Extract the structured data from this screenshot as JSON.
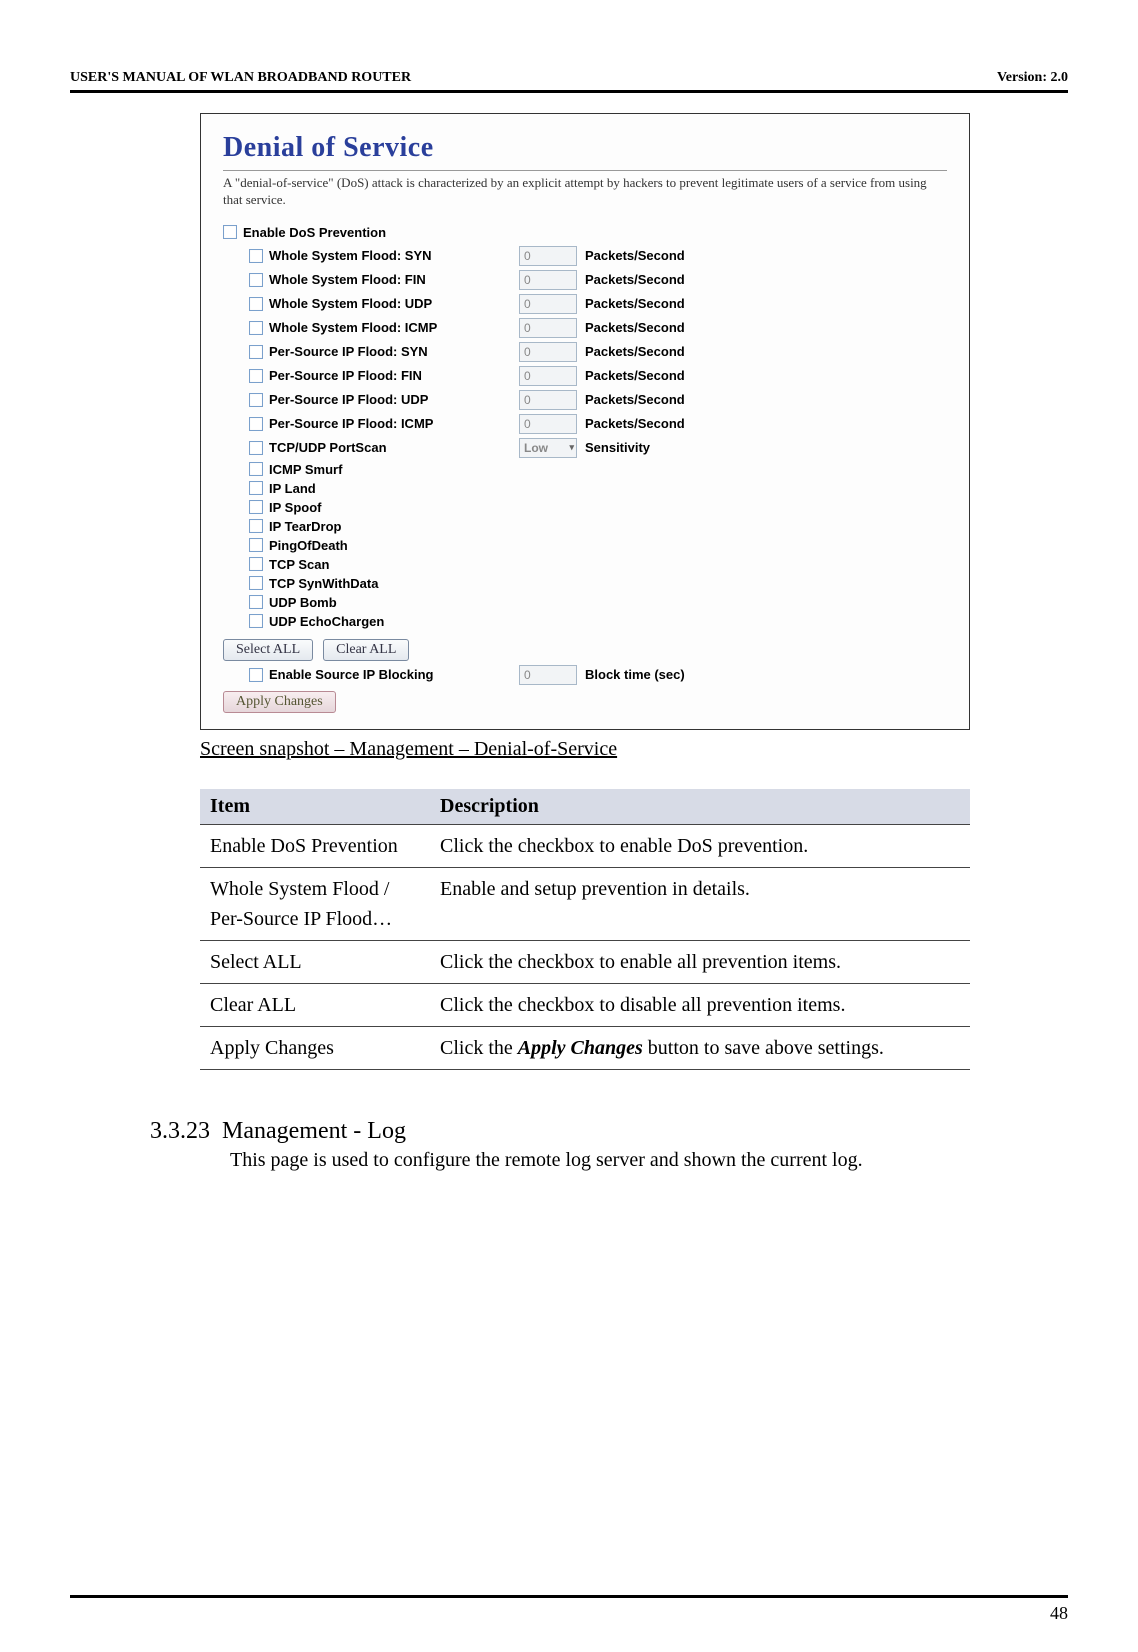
{
  "header": {
    "left": "USER'S MANUAL OF WLAN BROADBAND ROUTER",
    "right": "Version: 2.0"
  },
  "dos": {
    "title": "Denial of Service",
    "description": "A \"denial-of-service\" (DoS) attack is characterized by an explicit attempt by hackers to prevent legitimate users of a service from using that service.",
    "enable_label": "Enable DoS Prevention",
    "rows_with_value": [
      {
        "label": "Whole System Flood: SYN",
        "value": "0",
        "unit": "Packets/Second"
      },
      {
        "label": "Whole System Flood: FIN",
        "value": "0",
        "unit": "Packets/Second"
      },
      {
        "label": "Whole System Flood: UDP",
        "value": "0",
        "unit": "Packets/Second"
      },
      {
        "label": "Whole System Flood: ICMP",
        "value": "0",
        "unit": "Packets/Second"
      },
      {
        "label": "Per-Source IP Flood: SYN",
        "value": "0",
        "unit": "Packets/Second"
      },
      {
        "label": "Per-Source IP Flood: FIN",
        "value": "0",
        "unit": "Packets/Second"
      },
      {
        "label": "Per-Source IP Flood: UDP",
        "value": "0",
        "unit": "Packets/Second"
      },
      {
        "label": "Per-Source IP Flood: ICMP",
        "value": "0",
        "unit": "Packets/Second"
      }
    ],
    "portscan": {
      "label": "TCP/UDP PortScan",
      "select_value": "Low",
      "unit": "Sensitivity"
    },
    "rows_simple": [
      "ICMP Smurf",
      "IP Land",
      "IP Spoof",
      "IP TearDrop",
      "PingOfDeath",
      "TCP Scan",
      "TCP SynWithData",
      "UDP Bomb",
      "UDP EchoChargen"
    ],
    "buttons": {
      "select_all": "Select ALL",
      "clear_all": "Clear ALL",
      "apply": "Apply Changes"
    },
    "source_block": {
      "label": "Enable Source IP Blocking",
      "value": "0",
      "unit": "Block time (sec)"
    }
  },
  "caption": "Screen snapshot – Management – Denial-of-Service",
  "table": {
    "headers": {
      "item": "Item",
      "description": "Description"
    },
    "rows": [
      {
        "item": "Enable DoS Prevention",
        "desc": "Click the checkbox to enable DoS prevention."
      },
      {
        "item": "Whole System Flood / Per-Source IP Flood…",
        "desc": "Enable and setup prevention in details."
      },
      {
        "item": "Select ALL",
        "desc": "Click the checkbox to enable all prevention items."
      },
      {
        "item": "Clear ALL",
        "desc": "Click the checkbox to disable all prevention items."
      },
      {
        "item": "Apply Changes",
        "desc_prefix": "Click the ",
        "desc_em": "Apply Changes",
        "desc_suffix": " button to save above settings."
      }
    ]
  },
  "section": {
    "number": "3.3.23",
    "title": "Management - Log",
    "body": "This page is used to configure the remote log server and shown the current log."
  },
  "page_number": "48"
}
